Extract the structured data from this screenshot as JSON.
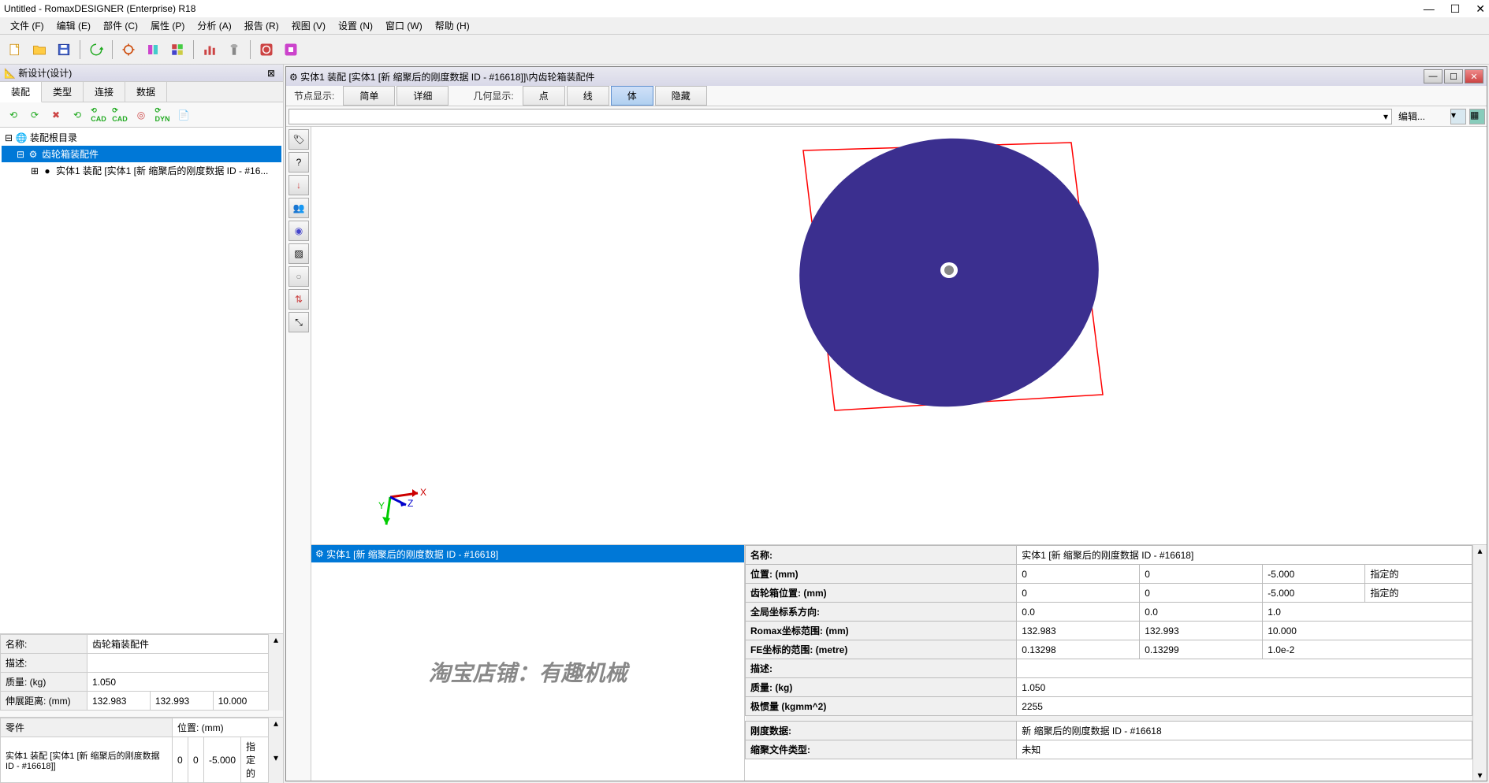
{
  "window_title": "Untitled - RomaxDESIGNER (Enterprise) R18",
  "menus": [
    "文件 (F)",
    "编辑 (E)",
    "部件 (C)",
    "属性 (P)",
    "分析 (A)",
    "报告 (R)",
    "视图 (V)",
    "设置 (N)",
    "窗口 (W)",
    "帮助 (H)"
  ],
  "left_panel": {
    "title": "新设计(设计)",
    "tabs": [
      "装配",
      "类型",
      "连接",
      "数据"
    ],
    "tree": {
      "root": "装配根目录",
      "child1": "齿轮箱装配件",
      "child2": "实体1 装配 [实体1 [新 缩聚后的刚度数据 ID - #16..."
    },
    "props1": {
      "name_label": "名称:",
      "name_value": "齿轮箱装配件",
      "desc_label": "描述:",
      "mass_label": "质量: (kg)",
      "mass_value": "1.050",
      "extent_label": "伸展距离: (mm)",
      "extent_v1": "132.983",
      "extent_v2": "132.993",
      "extent_v3": "10.000"
    },
    "props2": {
      "part_label": "零件",
      "pos_label": "位置: (mm)",
      "part_value": "实体1 装配 [实体1 [新 缩聚后的刚度数据 ID - #16618]]",
      "pos_v1": "0",
      "pos_v2": "0",
      "pos_v3": "-5.000",
      "spec": "指定的"
    }
  },
  "doc_window": {
    "title": "实体1 装配  [实体1 [新 缩聚后的刚度数据 ID - #16618]]\\内齿轮箱装配件",
    "node_display_label": "节点显示:",
    "simple_btn": "简单",
    "detail_btn": "详细",
    "geom_display_label": "几何显示:",
    "point_btn": "点",
    "line_btn": "线",
    "body_btn": "体",
    "hide_btn": "隐藏",
    "edit_label": "编辑...",
    "selected_item": "实体1 [新 缩聚后的刚度数据 ID - #16618]"
  },
  "watermark_text": "淘宝店铺：有趣机械",
  "right_props": {
    "name_label": "名称:",
    "name_value": "实体1 [新 缩聚后的刚度数据 ID - #16618]",
    "pos_label": "位置: (mm)",
    "pos": [
      "0",
      "0",
      "-5.000",
      "指定的"
    ],
    "boxpos_label": "齿轮箱位置: (mm)",
    "boxpos": [
      "0",
      "0",
      "-5.000",
      "指定的"
    ],
    "global_label": "全局坐标系方向:",
    "global": [
      "0.0",
      "0.0",
      "1.0"
    ],
    "romax_label": "Romax坐标范围:   (mm)",
    "romax": [
      "132.983",
      "132.993",
      "10.000"
    ],
    "fe_label": "FE坐标的范围:  (metre)",
    "fe": [
      "0.13298",
      "0.13299",
      "1.0e-2"
    ],
    "desc_label": "描述:",
    "mass_label": "质量: (kg)",
    "mass_value": "1.050",
    "inertia_label": "极惯量 (kgmm^2)",
    "inertia_value": "2255",
    "stiff_label": "刚度数据:",
    "stiff_value": "新 缩聚后的刚度数据 ID - #16618",
    "filetype_label": "缩聚文件类型:",
    "filetype_value": "未知"
  }
}
